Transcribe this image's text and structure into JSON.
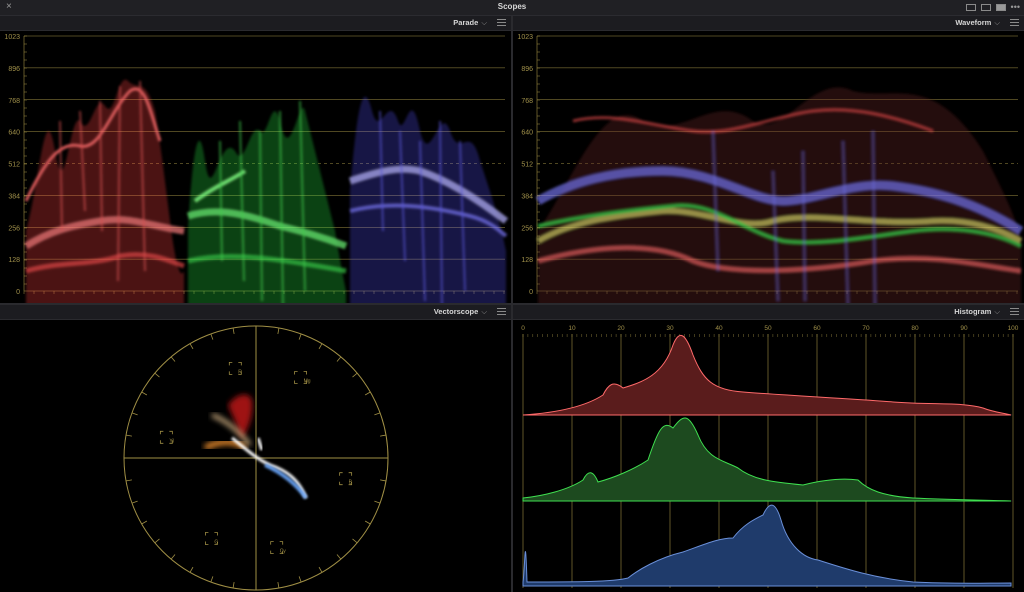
{
  "window": {
    "title": "Scopes",
    "close_glyph": "×",
    "more_glyph": "•••"
  },
  "panels": {
    "parade": {
      "title": "Parade",
      "chevron": "⌵"
    },
    "waveform": {
      "title": "Waveform",
      "chevron": "⌵"
    },
    "vectorscope": {
      "title": "Vectorscope",
      "chevron": "⌵"
    },
    "histogram": {
      "title": "Histogram",
      "chevron": "⌵"
    }
  },
  "waveform_scale": [
    "1023",
    "896",
    "768",
    "640",
    "512",
    "384",
    "256",
    "128",
    "0"
  ],
  "histogram_scale": [
    "0",
    "10",
    "20",
    "30",
    "40",
    "50",
    "60",
    "70",
    "80",
    "90",
    "100"
  ],
  "vectorscope_targets": [
    "R",
    "Mg",
    "B",
    "Cy",
    "G",
    "Yl"
  ],
  "colors": {
    "red": "#ff5a5a",
    "green": "#38e84a",
    "blue": "#6f6bff",
    "grid": "#a08f45",
    "panel_bg": "#1c1c20"
  }
}
